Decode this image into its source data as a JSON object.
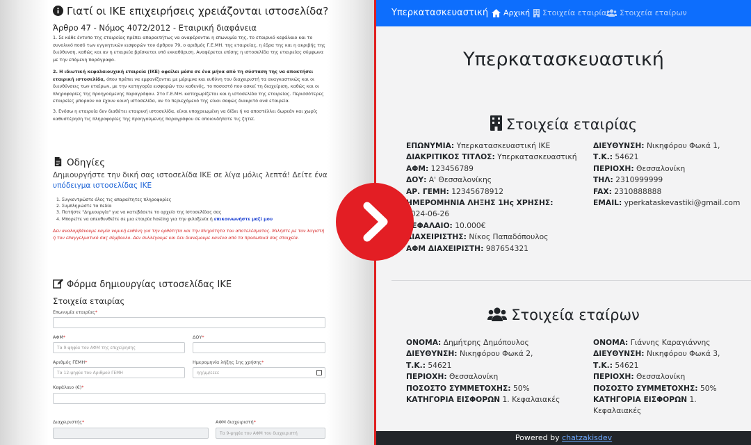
{
  "left": {
    "why_heading": "Γιατί οι ΙΚΕ επιχειρήσεις χρειάζονται ιστοσελίδα?",
    "article_heading": "Άρθρο 47 - Νόμος 4072/2012 - Εταιρική διαφάνεια",
    "p1": "1. Σε κάθε έντυπο της εταιρείας πρέπει απαραιτήτως να αναφέρονται η επωνυμία της, το εταιρικό κεφάλαιο και το συνολικό ποσό των εγγυητικών εισφορών του άρθρου 79, ο αριθμός Γ.Ε.ΜΗ. της εταιρείας, η έδρα της και η ακριβής της διεύθυνση, καθώς και αν η εταιρεία βρίσκεται υπό εκκαθάριση. Αναφέρεται επίσης η ιστοσελίδα της εταιρείας σύμφωνα με την επόμενη παράγραφο.",
    "p2_bold": "2. Η ιδιωτική κεφαλαιουχική εταιρεία (ΙΚΕ) οφείλει μέσα σε ένα μήνα από τη σύσταση της να αποκτήσει εταιρική ιστοσελίδα,",
    "p2_rest": " όπου πρέπει να εμφανίζονται με μέριμνα και ευθύνη του διαχειριστή τα αναγκαστικώς και οι διευθύνσεις των εταίρων, με την κατηγορία εισφορών του καθενός, το ποσοστό που ασκεί τη διαχείριση, καθώς και οι πληροφορίες της προηγούμενης παραγράφου. Στο Γ.Ε.ΜΗ. καταχωρίζεται και η ιστοσελίδα της εταιρείας. Περισσότερες εταιρείες μπορούν να έχουν κοινή ιστοσελίδα, αν το περιεχόμενό της είναι σαφώς διακριτό ανά εταιρεία.",
    "p3": "3. Ενόσω η εταιρεία δεν διαθέτει εταιρική ιστοσελίδα, είναι υποχρεωμένη να δίδει ή να αποστέλλει δωρεάν και χωρίς καθυστέρηση τις πληροφορίες της προηγούμενης παραγράφου σε οποιονδήποτε τις ζητεί.",
    "guide_heading": "Οδηγίες",
    "guide_intro": "Δημιουργήστε την δική σας ιστοσελίδα ΙΚΕ σε λίγα μόλις λεπτά! Δείτε ένα ",
    "guide_link": "υπόδειγμα ιστοσελίδας ΙΚΕ",
    "steps": [
      "1. Συγκεντρώστε όλες τις απαραίτητες πληροφορίες",
      "2. Συμπληρώστε τα πεδία",
      "3. Πατήστε \"Δημιουργία\" για να κατεβάσετε το αρχείο της Ιστοσελίδας σας",
      "4. Μπορείτε να απευθυνθείτε σε μια εταιρία hosting για την φιλοξενία ή "
    ],
    "step4_link": "επικοινωνήστε μαζί μου",
    "disclaimer": "Δεν αναλαμβάνουμε καμία νομική ευθύνη για την ορθότητα και την πληρότητα του αποτελέσματος. Μιλήστε με τον λογιστή ή τον επαγγελματικό σας σύμβουλο. Δεν συλλέγουμε και δεν διανέμουμε κανένα από τα προσωπικά σας στοιχεία.",
    "form_heading": "Φόρμα δημιουργίας ιστοσελίδας ΙΚΕ",
    "form_sub": "Στοιχεία εταιρίας",
    "fields": {
      "eponymia_label": "Επωνυμία εταιρίας",
      "afm_label": "ΑΦΜ",
      "afm_placeholder": "Τα 9-ψηφία του ΑΦΜ της επιχείρησης",
      "doy_label": "ΔΟΥ",
      "gemi_label": "Αριθμός ΓΕΜΗ",
      "gemi_placeholder": "Τα 12-ψηφία του Αριθμού ΓΕΜΗ",
      "date_label": "Ημερομηνία λήξης 1ης χρήσης",
      "date_placeholder": "ηη/μμ/εεεε",
      "capital_label": "Κεφάλαιο (€)",
      "manager_label": "Διαχειριστής",
      "manager_afm_label": "ΑΦΜ διαχειριστή",
      "manager_afm_placeholder": "Τα 9-ψηφία του ΑΦΜ του διαχειριστή",
      "required_mark": "*"
    }
  },
  "right": {
    "brand": "Υπερκατασκευαστική",
    "nav": {
      "home": "Αρχική",
      "company": "Στοιχεία εταιρίας",
      "partners": "Στοιχεία εταίρων"
    },
    "page_title": "Υπερκατασκευαστική",
    "company_title": "Στοιχεία εταιρίας",
    "company_left": [
      {
        "k": "ΕΠΩΝΥΜΙΑ:",
        "v": " Υπερκατασκευαστική ΙΚΕ"
      },
      {
        "k": "ΔΙΑΚΡΙΤΙΚΟΣ ΤΙΤΛΟΣ:",
        "v": " Υπερκατασκευαστική"
      },
      {
        "k": "ΑΦΜ:",
        "v": " 123456789"
      },
      {
        "k": "ΔΟΥ:",
        "v": " Α' Θεσσαλονίκης"
      },
      {
        "k": "ΑΡ. ΓΕΜΗ:",
        "v": " 12345678912"
      },
      {
        "k": "ΗΜΕΡΟΜΗΝΙΑ ΛΗΞΗΣ 1Ης ΧΡΗΣΗΣ:",
        "v": " 2024-06-26"
      },
      {
        "k": "ΚΕΦΑΛΑΙΟ:",
        "v": " 10.000€"
      },
      {
        "k": "ΔΙΑΧΕΙΡΙΣΤΗΣ:",
        "v": " Νίκος Παπαδόπουλος"
      },
      {
        "k": "ΑΦΜ ΔΙΑΧΕΙΡΙΣΤΗ:",
        "v": " 987654321"
      }
    ],
    "company_right": [
      {
        "k": "ΔΙΕΥΘΥΝΣΗ:",
        "v": " Νικηφόρου Φωκά 1,"
      },
      {
        "k": "Τ.Κ.:",
        "v": " 54621"
      },
      {
        "k": "ΠΕΡΙΟΧΗ:",
        "v": " Θεσσαλονίκη"
      },
      {
        "k": "ΤΗΛ:",
        "v": " 2310999999"
      },
      {
        "k": "FAX:",
        "v": " 2310888888"
      },
      {
        "k": "EMAIL:",
        "v": " yperkataskevastiki@gmail.com"
      }
    ],
    "partners_title": "Στοιχεία εταίρων",
    "partner1": [
      {
        "k": "ΟΝΟΜΑ:",
        "v": " Δημήτρης Δημόπουλος"
      },
      {
        "k": "ΔΙΕΥΘΥΝΣΗ:",
        "v": " Νικηφόρου Φωκά 2,"
      },
      {
        "k": "Τ.Κ.:",
        "v": " 54621"
      },
      {
        "k": "ΠΕΡΙΟΧΗ:",
        "v": " Θεσσαλονίκη"
      },
      {
        "k": "ΠΟΣΟΣΤΟ ΣΥΜΜΕΤΟΧΗΣ:",
        "v": " 50%"
      },
      {
        "k": "ΚΑΤΗΓΟΡΙΑ ΕΙΣΦΟΡΩΝ",
        "v": " 1. Κεφαλαιακές"
      }
    ],
    "partner2": [
      {
        "k": "ΟΝΟΜΑ:",
        "v": " Γιάννης Καραγιάννης"
      },
      {
        "k": "ΔΙΕΥΘΥΝΣΗ:",
        "v": " Νικηφόρου Φωκά 3,"
      },
      {
        "k": "Τ.Κ.:",
        "v": " 54621"
      },
      {
        "k": "ΠΕΡΙΟΧΗ:",
        "v": " Θεσσαλονίκη"
      },
      {
        "k": "ΠΟΣΟΣΤΟ ΣΥΜΜΕΤΟΧΗΣ:",
        "v": " 50%"
      },
      {
        "k": "ΚΑΤΗΓΟΡΙΑ ΕΙΣΦΟΡΩΝ",
        "v": " 1. Κεφαλαιακές"
      }
    ],
    "footer_text": "Powered by ",
    "footer_link": "chatzakisdev"
  },
  "colors": {
    "navbar": "#0d6efd",
    "divider": "#e02020",
    "arrow_button": "#e31e24",
    "footer": "#222529",
    "link": "#1a62d6",
    "disclaimer": "#d62828"
  }
}
